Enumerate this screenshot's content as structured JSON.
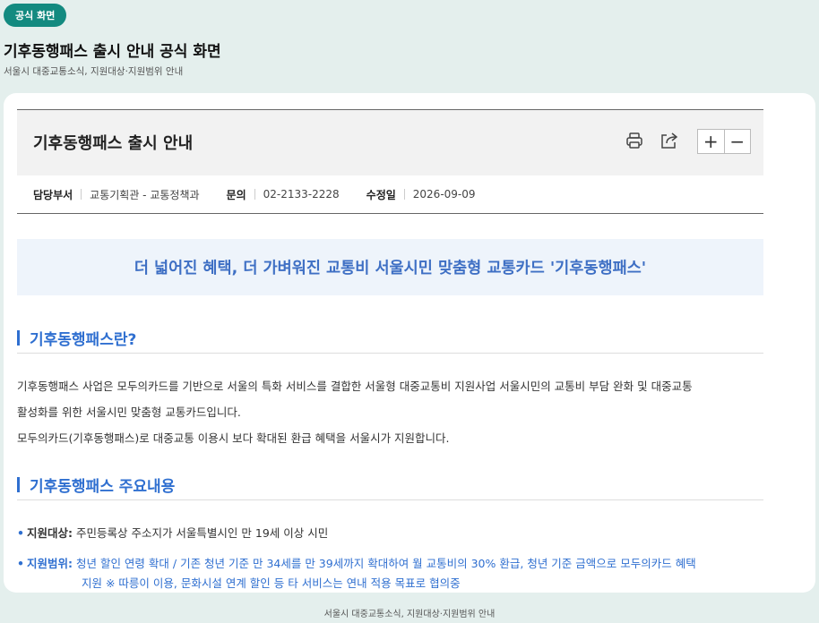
{
  "badge": "공식 화면",
  "page_title": "기후동행패스 출시 안내 공식 화면",
  "page_subtitle": "서울시 대중교통소식, 지원대상·지원범위 안내",
  "article": {
    "title": "기후동행패스 출시 안내",
    "toolbar": {
      "print_icon": "printer-icon",
      "share_icon": "share-icon",
      "zoom_in": "+",
      "zoom_out": "−"
    },
    "meta": [
      {
        "label": "담당부서",
        "value": "교통기획관 - 교통정책과"
      },
      {
        "label": "문의",
        "value": "02-2133-2228"
      },
      {
        "label": "수정일",
        "value": "2026-09-09"
      }
    ],
    "highlight": "더 넓어진 혜택, 더 가벼워진 교통비 서울시민 맞춤형 교통카드 '기후동행패스'",
    "section1": {
      "title": "기후동행패스란?",
      "lines": [
        "기후동행패스 사업은 모두의카드를 기반으로 서울의 특화 서비스를 결합한 서울형 대중교통비 지원사업 서울시민의 교통비 부담 완화 및 대중교통",
        "활성화를 위한 서울시민 맞춤형 교통카드입니다.",
        "모두의카드(기후동행패스)로 대중교통 이용시 보다 확대된 환급 혜택을 서울시가 지원합니다."
      ]
    },
    "section2": {
      "title": "기후동행패스 주요내용",
      "items": [
        {
          "label": "지원대상:",
          "text": "주민등록상 주소지가 서울특별시인 만 19세 이상 시민"
        },
        {
          "label": "지원범위:",
          "text": "청년 할인 연령 확대  / 기존 청년 기준 만 34세를 만 39세까지 확대하여 월 교통비의 30% 환급, 청년 기준 금액으로 모두의카드 혜택",
          "text2": "지원 ※ 따릉이 이용, 문화시설 연계 할인 등 타 서비스는 연내 적용 목표로 협의중"
        }
      ]
    }
  },
  "footer": "서울시 대중교통소식, 지원대상·지원범위 안내"
}
